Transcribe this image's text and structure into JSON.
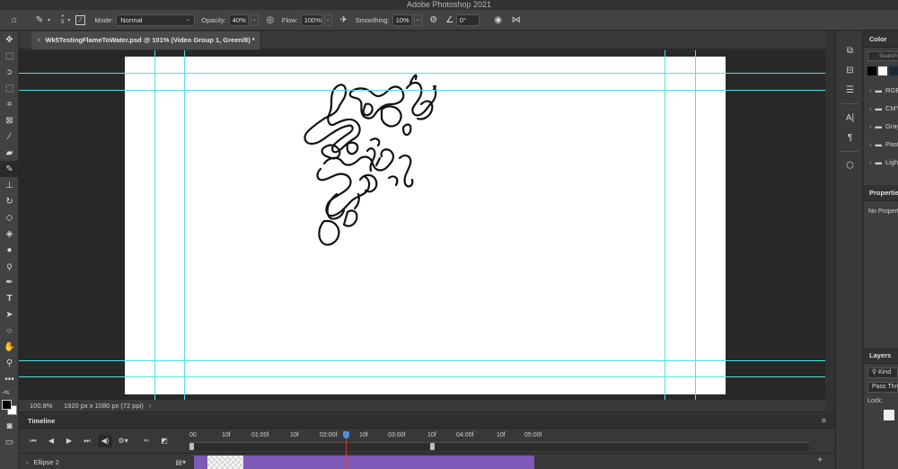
{
  "app": {
    "title": "Adobe Photoshop 2021"
  },
  "options_bar": {
    "brush_size": "5",
    "mode_label": "Mode:",
    "mode_value": "Normal",
    "opacity_label": "Opacity:",
    "opacity_value": "40%",
    "flow_label": "Flow:",
    "flow_value": "100%",
    "smoothing_label": "Smoothing:",
    "smoothing_value": "10%",
    "angle_value": "0°"
  },
  "document": {
    "tab_title": "Wk5TestingFlameToWater.psd @ 101% (Video Group 1, Green/8) *",
    "close_glyph": "×"
  },
  "status_bar": {
    "zoom": "100.8%",
    "doc_info": "1920 px x 1080 px (72 ppi)",
    "chevron": "›"
  },
  "timeline": {
    "title": "Timeline",
    "menu_glyph": "≡",
    "ruler_labels": [
      "00",
      "10f",
      "01:00f",
      "10f",
      "02:00f",
      "10f",
      "03:00f",
      "10f",
      "04:00f",
      "10f",
      "05:00f"
    ],
    "track": {
      "name": "Ellipse 2",
      "expand_glyph": "›",
      "film_glyph": "▤▾"
    },
    "add_glyph": "+"
  },
  "tools": [
    "move-icon",
    "marquee-icon",
    "lasso-icon",
    "quick-select-icon",
    "crop-icon",
    "frame-icon",
    "eyedropper-icon",
    "healing-icon",
    "brush-icon",
    "stamp-icon",
    "history-brush-icon",
    "eraser-icon",
    "paint-bucket-icon",
    "blur-icon",
    "dodge-icon",
    "pen-icon",
    "type-icon",
    "path-select-icon",
    "ellipse-icon",
    "hand-icon",
    "zoom-icon",
    "more-icon"
  ],
  "panels": {
    "color": {
      "title": "Color",
      "search_placeholder": "Search"
    },
    "swatch_colors": [
      "#000000",
      "#ffffff",
      "#1a2a3a"
    ],
    "folders": [
      "RGB",
      "CMYK",
      "Grayscale",
      "Pastel",
      "Light"
    ],
    "properties": {
      "title": "Properties",
      "body": "No Properties"
    },
    "layers": {
      "title": "Layers",
      "kind_label": "Kind",
      "blend_value": "Pass Through",
      "lock_label": "Lock:"
    }
  },
  "colors": {
    "guide": "#4fe0e6",
    "clip": "#7e5ab8",
    "playhead": "#4d8ee8"
  }
}
